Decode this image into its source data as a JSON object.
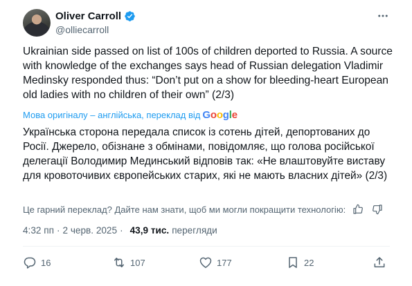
{
  "author": {
    "display_name": "Oliver Carroll",
    "handle": "@olliecarroll"
  },
  "tweet": {
    "text": "Ukrainian side passed on list of 100s of children deported to Russia. A source with knowledge of the exchanges says head of Russian delegation Vladimir Medinsky responded thus: “Don’t put on a show for bleeding-heart European old ladies with no children of their own” (2/3)"
  },
  "translation": {
    "note": "Мова оригіналу – англійська, переклад від",
    "provider": "Google",
    "text": "Українська сторона передала список із сотень дітей, депортованих до Росії. Джерело, обізнане з обмінами, повідомляє, що голова російської делегації Володимир Мединський відповів так: «Не влаштовуйте виставу для кровоточивих європейських старих, які не мають власних дітей» (2/3)",
    "feedback_question": "Це гарний переклад? Дайте нам знати, щоб ми могли покращити технологію:"
  },
  "meta": {
    "time": "4:32 пп",
    "date": "2 черв. 2025",
    "views_count": "43,9 тис.",
    "views_label": "перегляди"
  },
  "actions": {
    "replies": "16",
    "reposts": "107",
    "likes": "177",
    "bookmarks": "22"
  },
  "colors": {
    "accent": "#1d9bf0",
    "secondary_text": "#536471",
    "primary_text": "#0f1419"
  }
}
